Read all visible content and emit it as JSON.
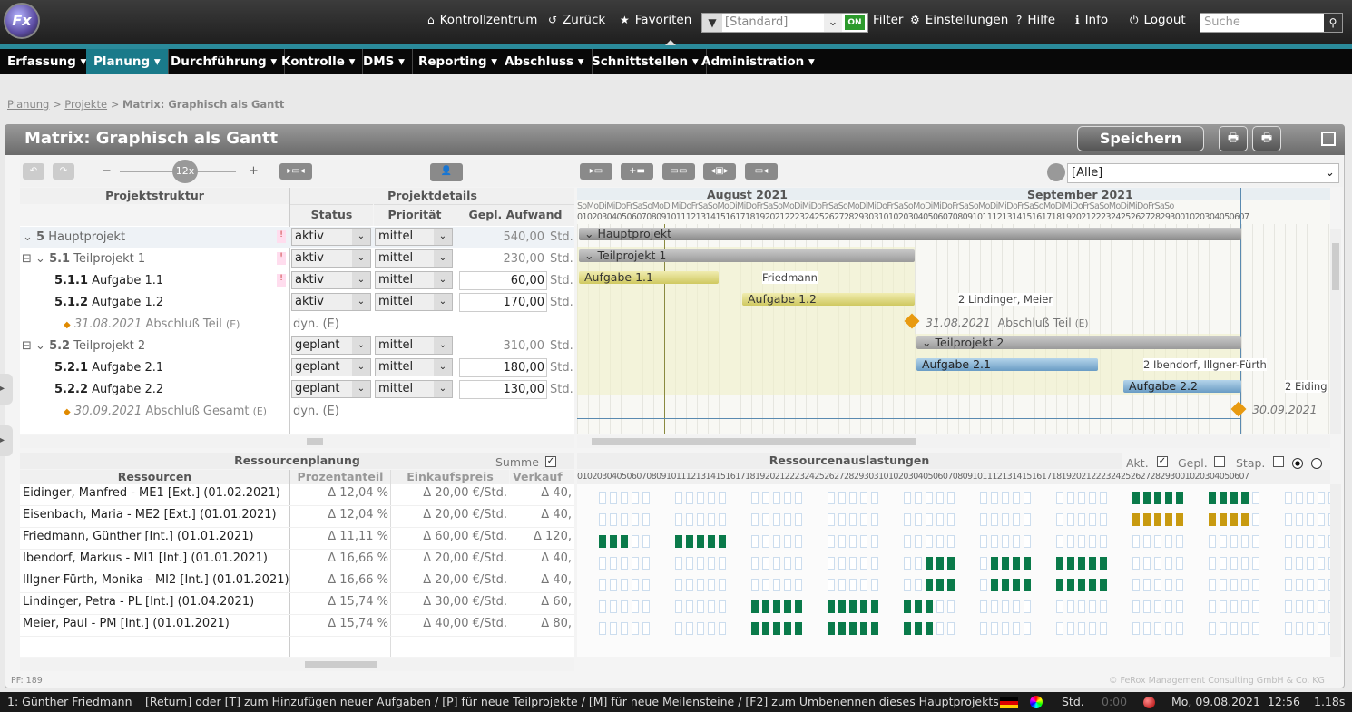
{
  "app": {
    "logo_text": "Fx"
  },
  "topnav": {
    "items": [
      {
        "label": "Kontrollzentrum",
        "icon": "home-icon"
      },
      {
        "label": "Zurück",
        "icon": "undo-icon"
      },
      {
        "label": "Favoriten",
        "icon": "star-icon"
      }
    ],
    "filter_value": "[Standard]",
    "filter_on": "ON",
    "filter_label": "Filter",
    "right_items": [
      {
        "label": "Einstellungen",
        "icon": "gear-icon"
      },
      {
        "label": "Hilfe",
        "icon": "help-icon"
      },
      {
        "label": "Info",
        "icon": "info-icon"
      },
      {
        "label": "Logout",
        "icon": "power-icon"
      }
    ],
    "search_placeholder": "Suche"
  },
  "menu": [
    "Erfassung ▾",
    "Planung ▾",
    "Durchführung ▾",
    "Kontrolle ▾",
    "DMS ▾",
    "Reporting ▾",
    "Abschluss ▾",
    "Schnittstellen ▾",
    "Administration ▾"
  ],
  "breadcrumb": {
    "a": "Planung",
    "b": "Projekte",
    "c": "Matrix: Graphisch als Gantt"
  },
  "panel": {
    "title": "Matrix: Graphisch als Gantt",
    "save": "Speichern",
    "zoom": "12x",
    "view_filter": "[Alle]"
  },
  "left_headers": {
    "struct": "Projektstruktur",
    "details": "Projektdetails",
    "status": "Status",
    "prio": "Priorität",
    "effort": "Gepl. Aufwand"
  },
  "rows": [
    {
      "code": "5",
      "name": "Hauptprojekt",
      "status": "aktiv",
      "prio": "mittel",
      "effort": "540,00",
      "unit": "Std."
    },
    {
      "code": "5.1",
      "name": "Teilprojekt 1",
      "status": "aktiv",
      "prio": "mittel",
      "effort": "230,00",
      "unit": "Std."
    },
    {
      "code": "5.1.1",
      "name": "Aufgabe 1.1",
      "status": "aktiv",
      "prio": "mittel",
      "effort": "60,00",
      "unit": "Std."
    },
    {
      "code": "5.1.2",
      "name": "Aufgabe 1.2",
      "status": "aktiv",
      "prio": "mittel",
      "effort": "170,00",
      "unit": "Std."
    },
    {
      "code": "31.08.2021",
      "name": "Abschluß Teil",
      "suffix": "(E)",
      "status": "dyn. (E)"
    },
    {
      "code": "5.2",
      "name": "Teilprojekt 2",
      "status": "geplant",
      "prio": "mittel",
      "effort": "310,00",
      "unit": "Std."
    },
    {
      "code": "5.2.1",
      "name": "Aufgabe 2.1",
      "status": "geplant",
      "prio": "mittel",
      "effort": "180,00",
      "unit": "Std."
    },
    {
      "code": "5.2.2",
      "name": "Aufgabe 2.2",
      "status": "geplant",
      "prio": "mittel",
      "effort": "130,00",
      "unit": "Std."
    },
    {
      "code": "30.09.2021",
      "name": "Abschluß Gesamt",
      "suffix": "(E)",
      "status": "dyn. (E)"
    }
  ],
  "gantt": {
    "month1": "August 2021",
    "month2": "September 2021",
    "bars": [
      "Hauptprojekt",
      "Teilprojekt 1",
      "Aufgabe 1.1",
      "Aufgabe 1.2",
      "Teilprojekt 2",
      "Aufgabe 2.1",
      "Aufgabe 2.2"
    ],
    "res_labels": [
      "Friedmann",
      "2 Lindinger, Meier",
      "2 Ibendorf, Illgner-Fürth",
      "2 Eiding"
    ],
    "ms1": "31.08.2021",
    "ms1_name": "Abschluß Teil",
    "ms1_suffix": "(E)",
    "ms2": "30.09.2021",
    "days": "SoMoDiMiDoFrSaSoMoDiMiDoFrSaSoMoDiMiDoFrSaSoMoDiMiDoFrSaSoMoDiMiDoFrSaSoMoDiMiDoFrSaSoMoDiMiDoFrSaSoMoDiMiDoFrSaSoMoDiMiDoFrSaSo",
    "nums": "0102030405060708091011121314151617181920212223242526272829303101020304050607080910111213141516171819202122232425262728293001020304050607"
  },
  "resources": {
    "title": "Ressourcenplanung",
    "sum_label": "Summe",
    "headers": {
      "name": "Ressourcen",
      "pct": "Prozentanteil",
      "buy": "Einkaufspreis",
      "sell": "Verkauf"
    },
    "rows": [
      {
        "name": "Eidinger, Manfred - ME1 [Ext.] (01.02.2021)",
        "pct": "Δ 12,04 %",
        "buy": "Δ 20,00 €/Std.",
        "sell": "Δ 40,"
      },
      {
        "name": "Eisenbach, Maria - ME2 [Ext.] (01.01.2021)",
        "pct": "Δ 12,04 %",
        "buy": "Δ 20,00 €/Std.",
        "sell": "Δ 40,"
      },
      {
        "name": "Friedmann, Günther [Int.] (01.01.2021)",
        "pct": "Δ 11,11 %",
        "buy": "Δ 60,00 €/Std.",
        "sell": "Δ 120,"
      },
      {
        "name": "Ibendorf, Markus - MI1 [Int.] (01.01.2021)",
        "pct": "Δ 16,66 %",
        "buy": "Δ 20,00 €/Std.",
        "sell": "Δ 40,"
      },
      {
        "name": "Illgner-Fürth, Monika - MI2 [Int.] (01.01.2021)",
        "pct": "Δ 16,66 %",
        "buy": "Δ 20,00 €/Std.",
        "sell": "Δ 40,"
      },
      {
        "name": "Lindinger, Petra - PL [Int.] (01.04.2021)",
        "pct": "Δ 15,74 %",
        "buy": "Δ 30,00 €/Std.",
        "sell": "Δ 60,"
      },
      {
        "name": "Meier, Paul - PM [Int.] (01.01.2021)",
        "pct": "Δ 15,74 %",
        "buy": "Δ 40,00 €/Std.",
        "sell": "Δ 80,"
      }
    ],
    "load_title": "Ressourcenauslastungen",
    "akt": "Akt.",
    "gepl": "Gepl.",
    "stap": "Stap."
  },
  "footer": {
    "pf": "PF: 189",
    "copyright": "© FeRox Management Consulting GmbH & Co. KG"
  },
  "status": {
    "user": "1: Günther Friedmann",
    "hint": "[Return] oder [T] zum Hinzufügen neuer Aufgaben / [P] für neue Teilprojekte / [M] für neue Meilensteine / [F2] zum Umbenennen dieses Hauptprojekts",
    "unit": "Std.",
    "time": "0:00",
    "date": "Mo, 09.08.2021  12:56",
    "dur": "1.18s"
  }
}
